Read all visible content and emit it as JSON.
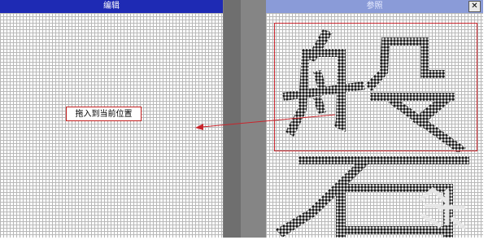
{
  "editor_panel": {
    "title": "编辑"
  },
  "reference_panel": {
    "title": "参照",
    "close_label": "✕"
  },
  "insert_hint": {
    "label": "拖入到当前位置"
  },
  "reference_character": {
    "glyph": "磐"
  },
  "colors": {
    "edit_title_bar": "#1e2ab4",
    "reference_title_bar": "#8a9bd8",
    "grid_line": "#b8b8b8",
    "selection_border": "#c9252c",
    "glyph_fill": "#1a1a1a"
  },
  "icons": {
    "close": "close-icon",
    "arrow": "drag-arrow-icon"
  }
}
